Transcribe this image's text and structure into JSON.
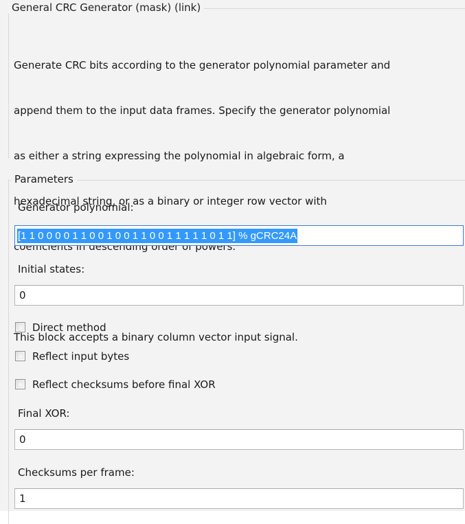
{
  "description": {
    "title": "General CRC Generator (mask) (link)",
    "lines": [
      "Generate CRC bits according to the generator polynomial parameter and",
      "append them to the input data frames. Specify the generator polynomial",
      "as either a string expressing the polynomial in algebraic form, a",
      "hexadecimal string, or as a binary or integer row vector with",
      "coefficients in descending order of powers.",
      "This block accepts a binary column vector input signal."
    ]
  },
  "parameters": {
    "title": "Parameters",
    "generator_polynomial": {
      "label": "Generator polynomial:",
      "value": "[1 1 0 0 0 0 1 1 0 0 1 0 0 1 1 0 0  1 1 1 1 1 0 1 1] % gCRC24A"
    },
    "initial_states": {
      "label": "Initial states:",
      "value": "0"
    },
    "direct_method": {
      "label": "Direct method",
      "checked": false
    },
    "reflect_input_bytes": {
      "label": "Reflect input bytes",
      "checked": false
    },
    "reflect_checksums": {
      "label": "Reflect checksums before final XOR",
      "checked": false
    },
    "final_xor": {
      "label": "Final XOR:",
      "value": "0"
    },
    "checksums_per_frame": {
      "label": "Checksums per frame:",
      "value": "1"
    }
  },
  "colors": {
    "selection": "#3399ff",
    "focus_border": "#3d7ad6",
    "panel_background": "#f3f3f3"
  }
}
